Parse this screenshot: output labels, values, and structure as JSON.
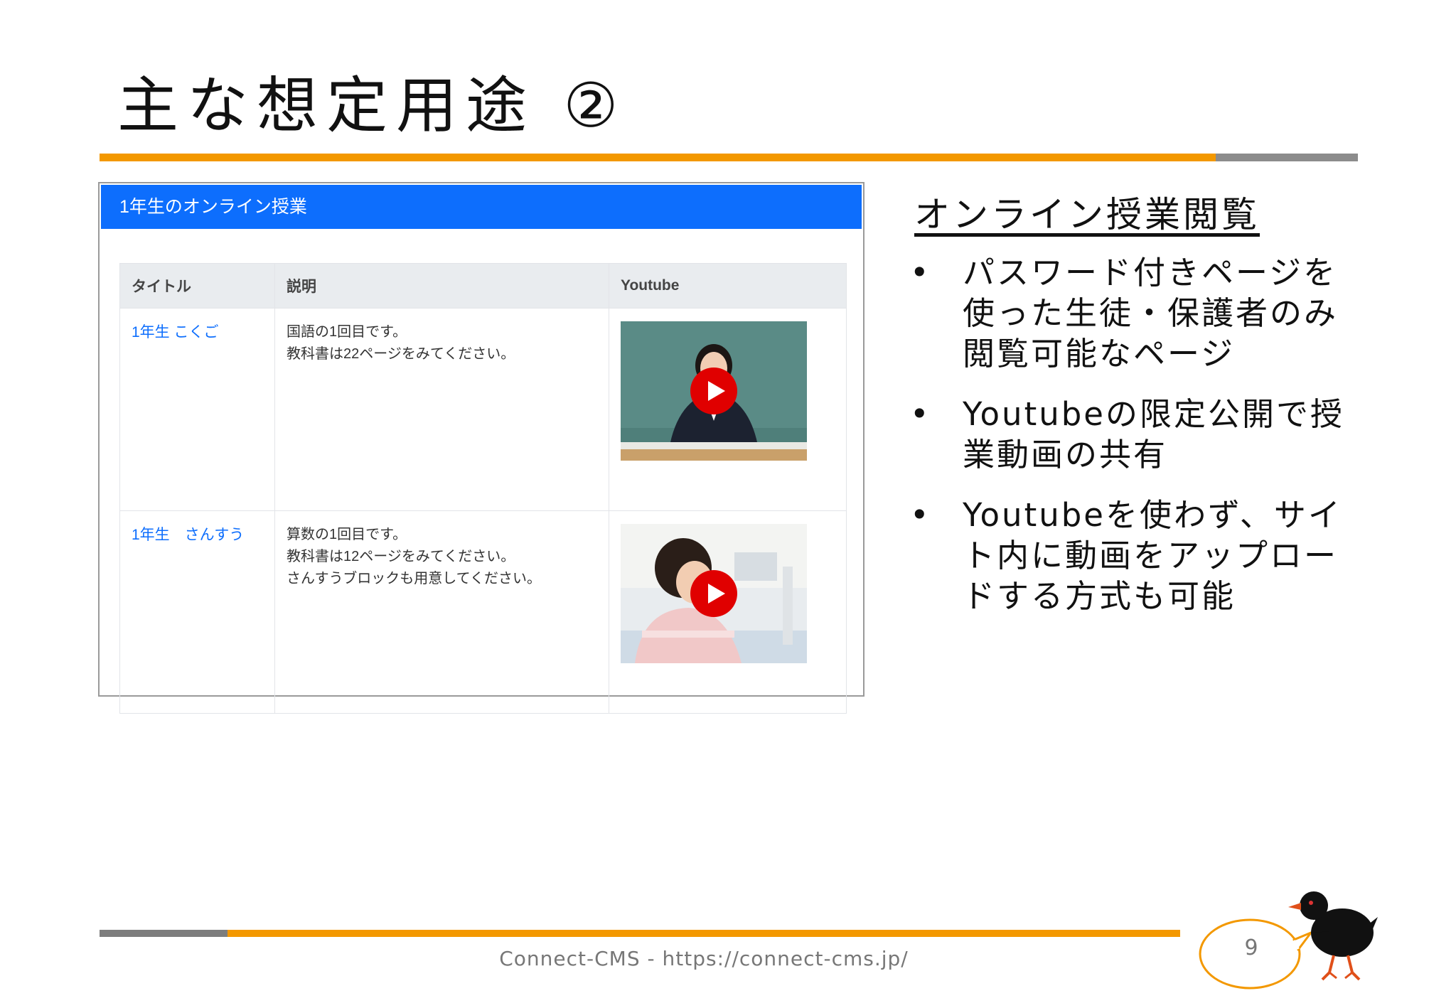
{
  "slide": {
    "title": "主な想定用途 ②",
    "footer": "Connect-CMS - https://connect-cms.jp/",
    "page_number": "9"
  },
  "screenshot": {
    "header": "1年生のオンライン授業",
    "columns": [
      "タイトル",
      "説明",
      "Youtube"
    ],
    "rows": [
      {
        "title": "1年生 こくご",
        "description": [
          "国語の1回目です。",
          "教科書は22ページをみてください。"
        ],
        "video_icon": "play-button-icon"
      },
      {
        "title": "1年生　さんすう",
        "description": [
          "算数の1回目です。",
          "教科書は12ページをみてください。",
          "さんすうブロックも用意してください。"
        ],
        "video_icon": "play-button-icon"
      }
    ]
  },
  "side": {
    "heading": "オンライン授業閲覧",
    "bullet_symbol": "•",
    "points": [
      "パスワード付きページを使った生徒・保護者のみ閲覧可能なページ",
      "Youtubeの限定公開で授業動画の共有",
      "Youtubeを使わず、サイト内に動画をアップロードする方式も可能"
    ]
  },
  "colors": {
    "accent_orange": "#f39800",
    "rule_gray": "#8c8c8c",
    "panel_blue": "#0d6efd",
    "play_red": "#e00000"
  }
}
